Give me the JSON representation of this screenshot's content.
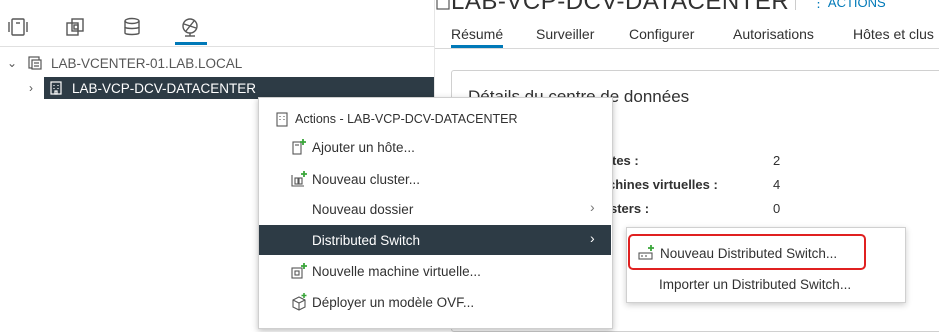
{
  "left_toolbar": {
    "icons": [
      "hosts-and-clusters-icon",
      "vms-and-templates-icon",
      "storage-icon",
      "networking-icon"
    ]
  },
  "tree": {
    "vcenter_label": "LAB-VCENTER-01.LAB.LOCAL",
    "datacenter_label": "LAB-VCP-DCV-DATACENTER"
  },
  "header": {
    "title": "LAB-VCP-DCV-DATACENTER",
    "actions_label": "ACTIONS",
    "tabs": [
      "Résumé",
      "Surveiller",
      "Configurer",
      "Autorisations",
      "Hôtes et clus"
    ]
  },
  "card": {
    "title": "Détails du centre de données",
    "rows": [
      {
        "label": "tes :",
        "value": "2"
      },
      {
        "label": "chines virtuelles :",
        "value": "4"
      },
      {
        "label": "sters :",
        "value": "0"
      }
    ]
  },
  "context_menu": {
    "header": "Actions - LAB-VCP-DCV-DATACENTER",
    "items": [
      {
        "label": "Ajouter un hôte...",
        "icon": "add-host-icon"
      },
      {
        "label": "Nouveau cluster...",
        "icon": "new-cluster-icon"
      },
      {
        "label": "Nouveau dossier",
        "icon": ""
      },
      {
        "label": "Distributed Switch",
        "icon": ""
      },
      {
        "label": "Nouvelle machine virtuelle...",
        "icon": "new-vm-icon"
      },
      {
        "label": "Déployer un modèle OVF...",
        "icon": "deploy-ovf-icon"
      }
    ]
  },
  "submenu": {
    "items": [
      {
        "label": "Nouveau Distributed Switch...",
        "icon": "new-distributed-switch-icon"
      },
      {
        "label": "Importer un Distributed Switch...",
        "icon": ""
      }
    ]
  },
  "colors": {
    "accent": "#0079b8",
    "selected_bg": "#2d3b45",
    "highlight": "#e02020",
    "add_green": "#3aa63a"
  }
}
